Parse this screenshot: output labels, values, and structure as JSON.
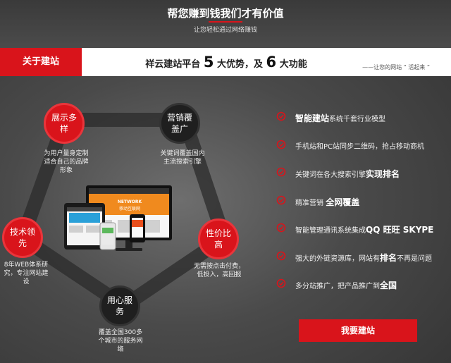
{
  "header": {
    "headline": "帮您赚到钱我们才有价值",
    "subline": "让您轻松通过网络赚钱"
  },
  "intro_bar": {
    "section_label": "关于建站",
    "title_prefix": "祥云建站平台",
    "num_advantages": "5",
    "title_mid": "大优势，及",
    "num_functions": "6",
    "title_suffix": "大功能",
    "slogan": "——让您的网站 “ 活起来 ”"
  },
  "advantages": [
    {
      "title": "展示多样",
      "desc": "为用户量身定制适合自己的品牌形象"
    },
    {
      "title": "营销覆盖广",
      "desc": "关键词覆盖国内主流搜索引擎"
    },
    {
      "title": "性价比高",
      "desc": "无需按点击付费，低投入，高回报"
    },
    {
      "title": "用心服务",
      "desc": "覆盖全国300多个城市的服务网络"
    },
    {
      "title": "技术领先",
      "desc": "8年WEB体系研究，专注网站建设"
    }
  ],
  "screen_banner": "移动互联网",
  "features": [
    {
      "pre": "",
      "bold": "智能建站",
      "post": "系统千套行业模型"
    },
    {
      "pre": "手机站和PC站同步二维码，抢占移动商机",
      "bold": "",
      "post": ""
    },
    {
      "pre": "关键词在各大搜索引擎",
      "bold": "实现排名",
      "post": ""
    },
    {
      "pre": "精准营销 ",
      "bold": "全网覆盖",
      "post": ""
    },
    {
      "pre": "智能管理通讯系统集成",
      "bold": "QQ 旺旺 SKYPE",
      "post": ""
    },
    {
      "pre": "强大的外链资源库，网站有",
      "bold": "排名",
      "post": "不再是问题"
    },
    {
      "pre": "多分站推广，把产品推广到",
      "bold": "全国",
      "post": ""
    }
  ],
  "cta_label": "我要建站",
  "colors": {
    "accent": "#d9141b",
    "dark_node": "#1f1f1f"
  }
}
